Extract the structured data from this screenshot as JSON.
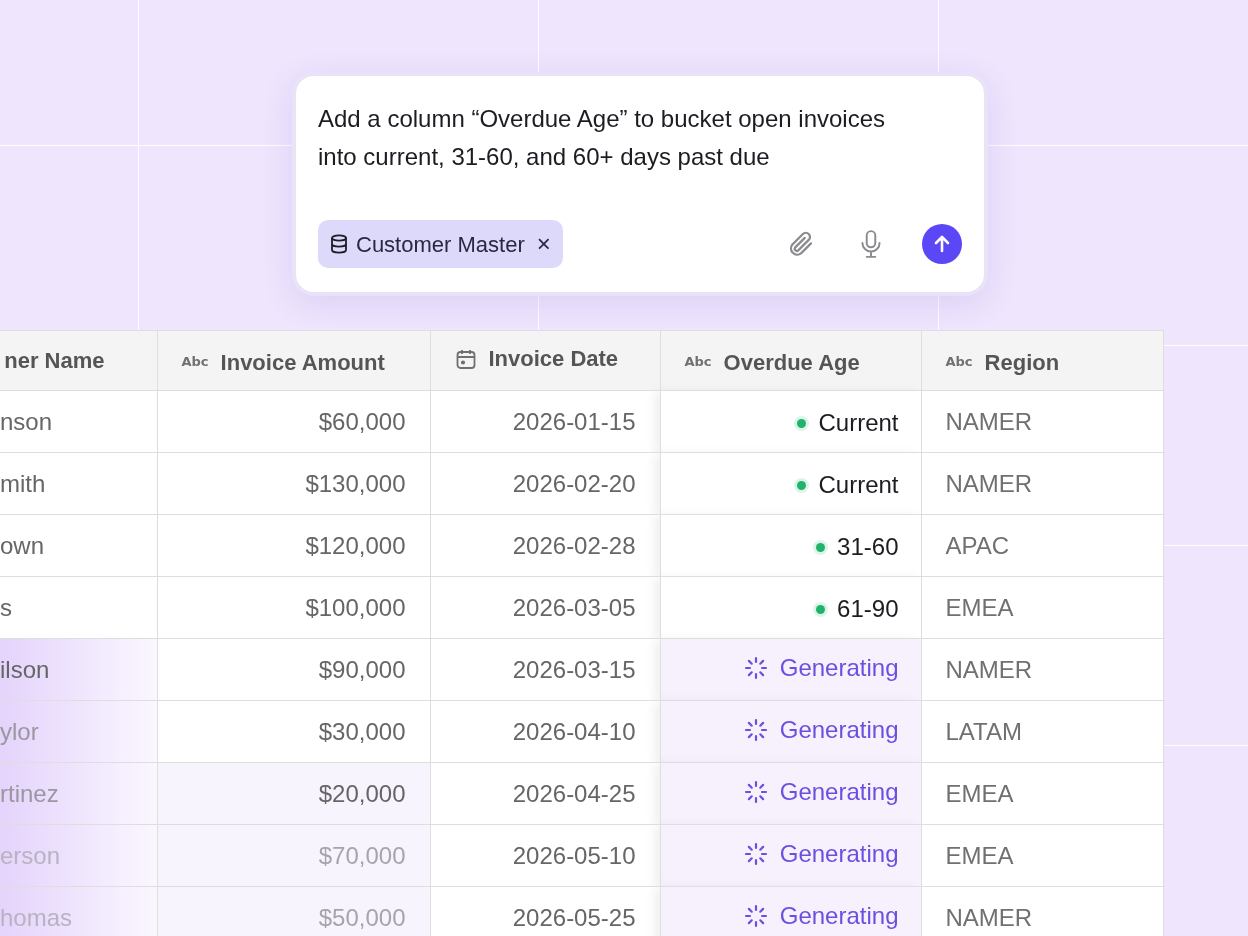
{
  "prompt": {
    "text": "Add a column “Overdue Age” to bucket open invoices into current, 31-60, and 60+ days past due",
    "chip": {
      "label": "Customer Master",
      "close": "×"
    }
  },
  "table": {
    "columns": [
      {
        "label": "ner Name",
        "kind": "plain"
      },
      {
        "label": "Invoice Amount",
        "kind": "text",
        "type_label": "Abc"
      },
      {
        "label": "Invoice Date",
        "kind": "date"
      },
      {
        "label": "Overdue Age",
        "kind": "text",
        "type_label": "Abc"
      },
      {
        "label": "Region",
        "kind": "text",
        "type_label": "Abc"
      }
    ],
    "rows": [
      {
        "name": "nson",
        "amount": "$60,000",
        "date": "2026-01-15",
        "age": {
          "kind": "ready",
          "label": "Current"
        },
        "region": "NAMER"
      },
      {
        "name": "mith",
        "amount": "$130,000",
        "date": "2026-02-20",
        "age": {
          "kind": "ready",
          "label": "Current"
        },
        "region": "NAMER"
      },
      {
        "name": "own",
        "amount": "$120,000",
        "date": "2026-02-28",
        "age": {
          "kind": "ready",
          "label": "31-60"
        },
        "region": "APAC"
      },
      {
        "name": "s",
        "amount": "$100,000",
        "date": "2026-03-05",
        "age": {
          "kind": "ready",
          "label": "61-90"
        },
        "region": "EMEA"
      },
      {
        "name": "ilson",
        "amount": "$90,000",
        "date": "2026-03-15",
        "age": {
          "kind": "generating",
          "label": "Generating"
        },
        "region": "NAMER"
      },
      {
        "name": "ylor",
        "amount": "$30,000",
        "date": "2026-04-10",
        "age": {
          "kind": "generating",
          "label": "Generating"
        },
        "region": "LATAM"
      },
      {
        "name": "rtinez",
        "amount": "$20,000",
        "date": "2026-04-25",
        "age": {
          "kind": "generating",
          "label": "Generating"
        },
        "region": "EMEA"
      },
      {
        "name": "erson",
        "amount": "$70,000",
        "date": "2026-05-10",
        "age": {
          "kind": "generating",
          "label": "Generating"
        },
        "region": "EMEA"
      },
      {
        "name": "homas",
        "amount": "$50,000",
        "date": "2026-05-25",
        "age": {
          "kind": "generating",
          "label": "Generating"
        },
        "region": "NAMER"
      }
    ]
  }
}
